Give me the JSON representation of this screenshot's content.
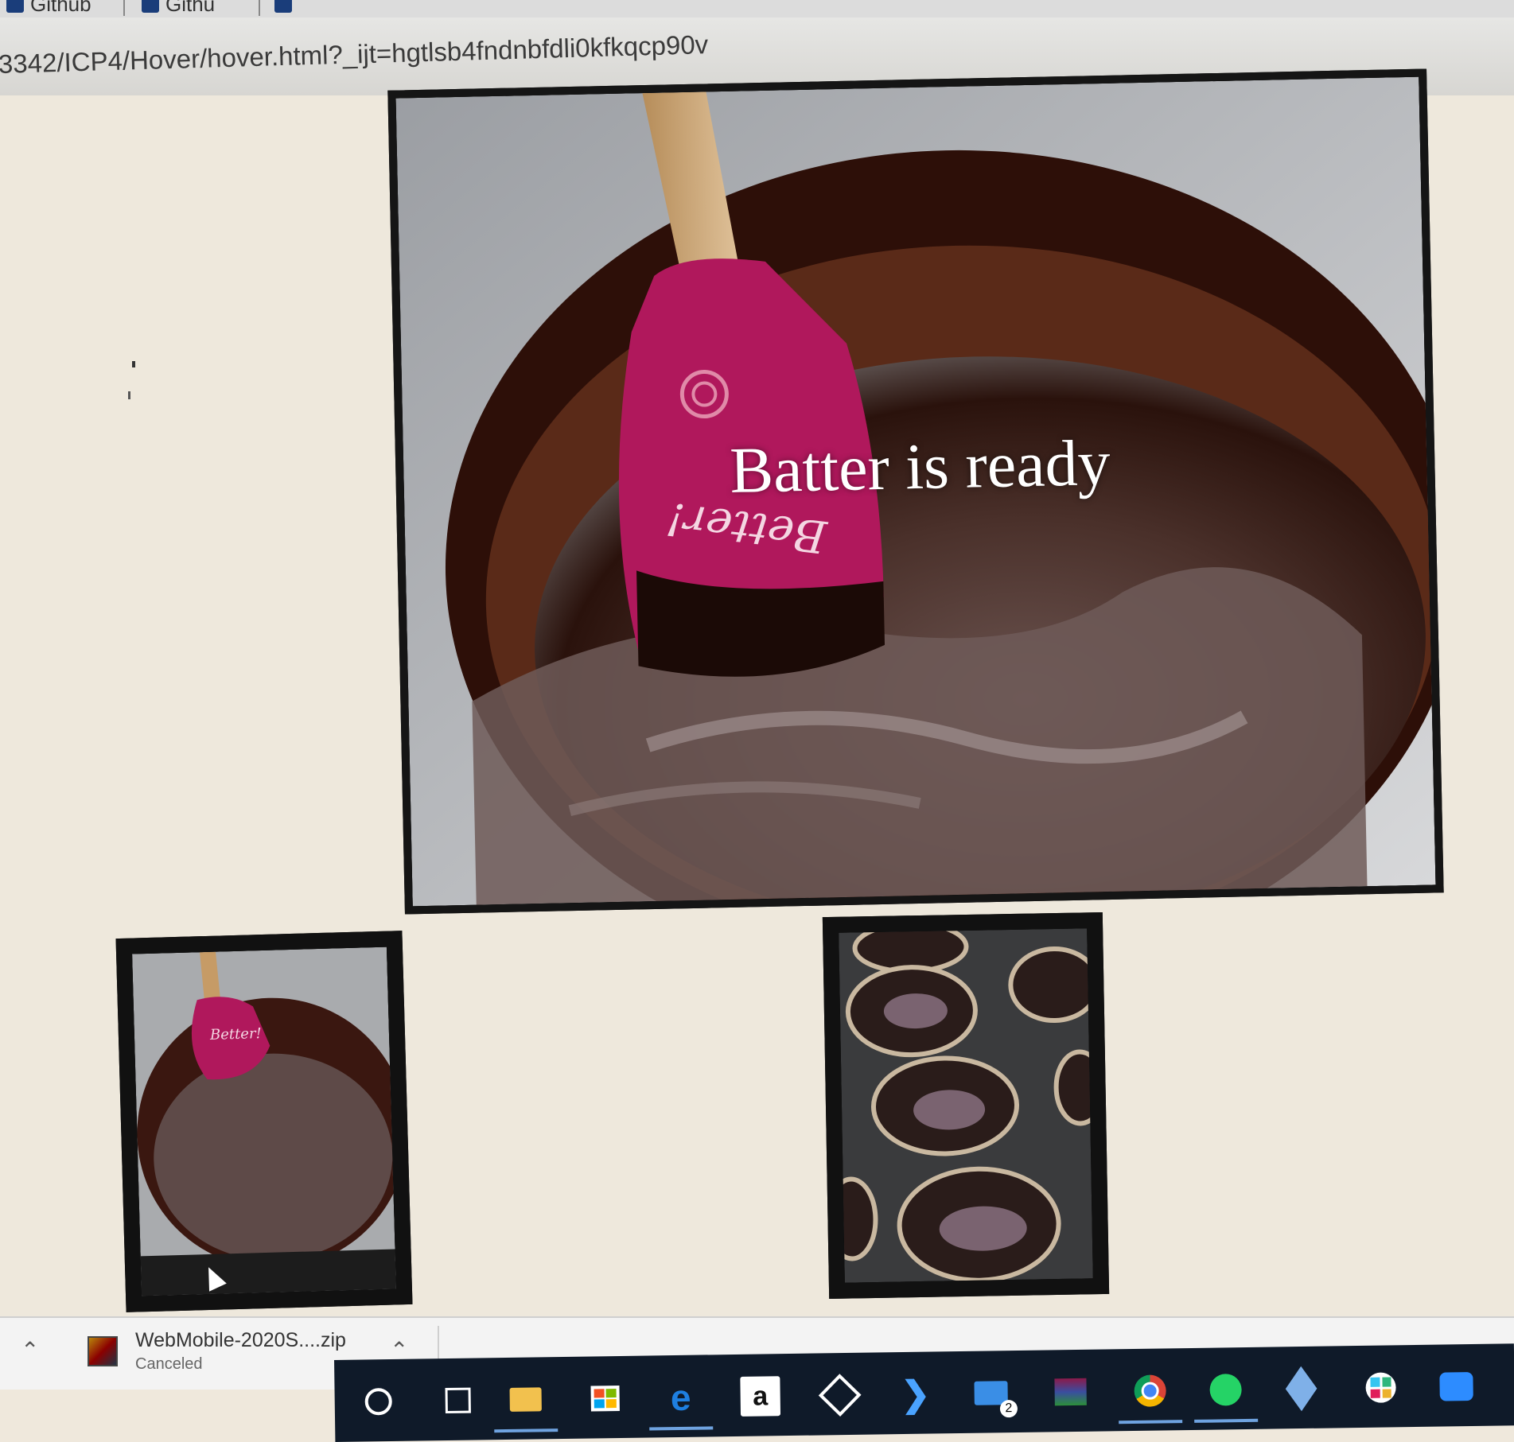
{
  "browser": {
    "bookmarks": [
      "Github",
      "Githu"
    ],
    "url": "3342/ICP4/Hover/hover.html?_ijt=hgtlsb4fndnbfdli0kfkqcp90v"
  },
  "page": {
    "main_caption": "Batter is ready",
    "spatula_script": "Better!",
    "thumb1_script": "Better!"
  },
  "downloads": {
    "file_name": "WebMobile-2020S....zip",
    "status": "Canceled"
  },
  "taskbar": {
    "icons": [
      "cortana-circle-icon",
      "task-view-icon",
      "file-explorer-icon",
      "store-icon",
      "edge-icon",
      "amazon-icon",
      "dropbox-icon",
      "visual-studio-icon",
      "mail-icon",
      "winrar-icon",
      "chrome-icon",
      "whatsapp-icon",
      "cube-icon",
      "slack-icon",
      "zoom-icon"
    ],
    "amazon_label": "a",
    "mail_badge": "2"
  },
  "colors": {
    "page_bg": "#eee8dc",
    "spatula": "#b0185c",
    "batter": "#3a1f14",
    "taskbar": "#0f1a29"
  }
}
